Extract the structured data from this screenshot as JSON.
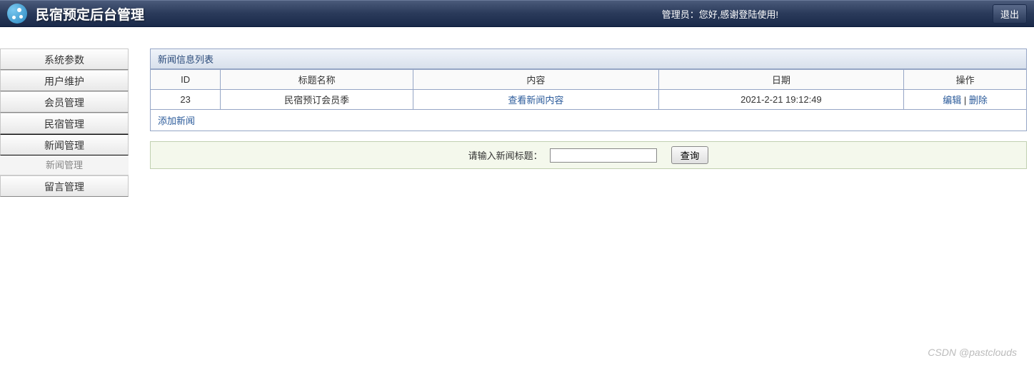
{
  "header": {
    "app_title": "民宿预定后台管理",
    "admin_label": "管理员：",
    "welcome": "您好,感谢登陆使用!",
    "logout": "退出"
  },
  "sidebar": {
    "items": [
      {
        "label": "系统参数"
      },
      {
        "label": "用户维护"
      },
      {
        "label": "会员管理"
      },
      {
        "label": "民宿管理"
      },
      {
        "label": "新闻管理"
      },
      {
        "label": "留言管理"
      }
    ],
    "sub_item": "新闻管理"
  },
  "panel": {
    "title": "新闻信息列表",
    "columns": [
      "ID",
      "标题名称",
      "内容",
      "日期",
      "操作"
    ],
    "rows": [
      {
        "id": "23",
        "title": "民宿预订会员季",
        "content_link": "查看新闻内容",
        "date": "2021-2-21 19:12:49",
        "action_edit": "编辑",
        "action_sep": " | ",
        "action_del": "删除"
      }
    ],
    "add_link": "添加新闻"
  },
  "search": {
    "label": "请输入新闻标题：",
    "value": "",
    "button": "查询"
  },
  "watermark": "CSDN @pastclouds"
}
